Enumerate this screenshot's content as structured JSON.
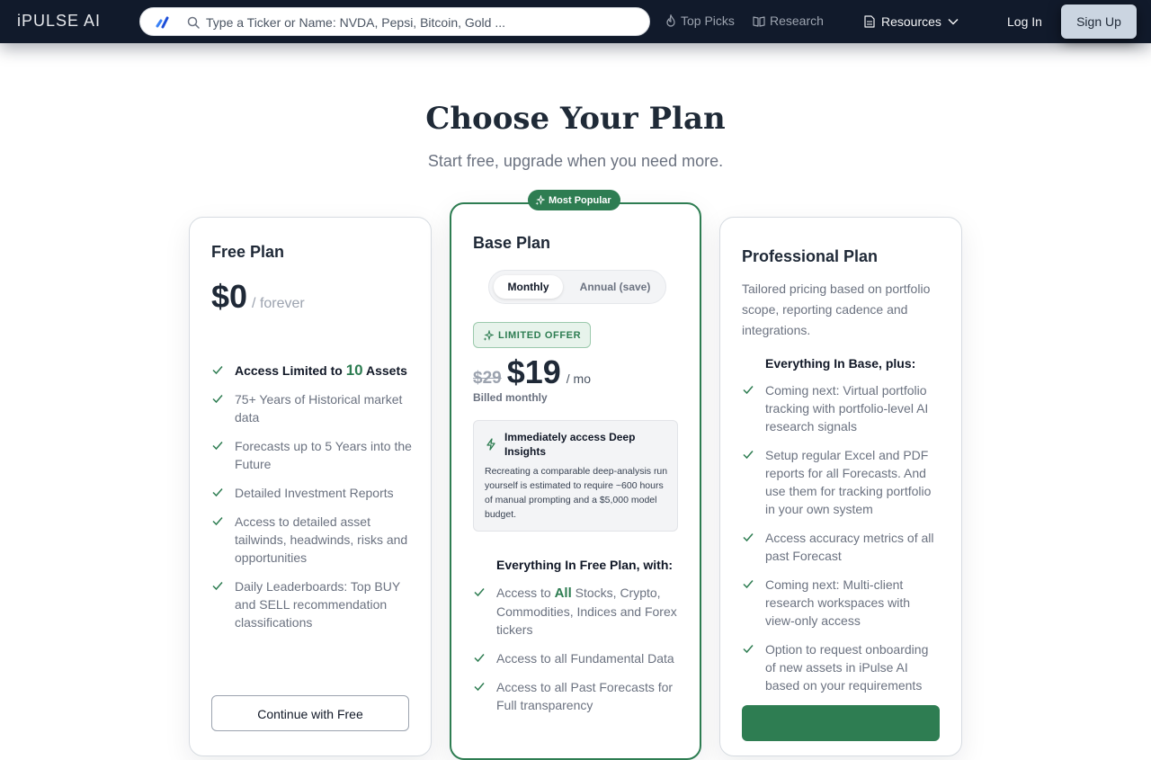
{
  "header": {
    "brand": "iPULSE AI",
    "search_placeholder": "Type a Ticker or Name: NVDA, Pepsi, Bitcoin, Gold ...",
    "nav": {
      "top_picks": "Top Picks",
      "research": "Research",
      "resources": "Resources"
    },
    "login": "Log In",
    "signup": "Sign Up"
  },
  "page": {
    "title": "Choose Your Plan",
    "subtitle": "Start free, upgrade when you need more."
  },
  "free_plan": {
    "title": "Free Plan",
    "price": "$0",
    "period": "/ forever",
    "features": [
      {
        "pre": "Access Limited to ",
        "highlight": "10",
        "post": " Assets",
        "bold": true
      },
      {
        "text": "75+ Years of Historical market data"
      },
      {
        "text": "Forecasts up to 5 Years into the Future"
      },
      {
        "text": "Detailed Investment Reports"
      },
      {
        "text": "Access to detailed asset tailwinds, headwinds, risks and opportunities"
      },
      {
        "text": "Daily Leaderboards: Top BUY and SELL recommendation classifications"
      }
    ],
    "cta": "Continue with Free"
  },
  "base_plan": {
    "badge": "Most Popular",
    "title": "Base Plan",
    "billing_options": [
      "Monthly",
      "Annual (save)"
    ],
    "offer_badge": "LIMITED OFFER",
    "old_price": "$29",
    "price": "$19",
    "period": "/ mo",
    "billing_note": "Billed monthly",
    "deep_title": "Immediately access Deep Insights",
    "deep_body": "Recreating a comparable deep-analysis run yourself is estimated to require ~600 hours of manual prompting and a $5,000 model budget.",
    "features_heading": "Everything In Free Plan, with:",
    "features": [
      {
        "pre": "Access to ",
        "highlight": "All",
        "post": " Stocks, Crypto, Commodities, Indices and Forex tickers"
      },
      {
        "text": "Access to all Fundamental Data"
      },
      {
        "text": "Access to all Past Forecasts for Full transparency"
      }
    ]
  },
  "pro_plan": {
    "title": "Professional Plan",
    "description": "Tailored pricing based on portfolio scope, reporting cadence and integrations.",
    "features_heading": "Everything In Base, plus:",
    "features": [
      {
        "text": "Coming next: Virtual portfolio tracking with portfolio-level AI research signals"
      },
      {
        "text": "Setup regular Excel and PDF reports for all Forecasts. And use them for tracking portfolio in your own system"
      },
      {
        "text": "Access accuracy metrics of all past Forecast"
      },
      {
        "text": "Coming next: Multi-client research workspaces with view-only access"
      },
      {
        "text": "Option to request onboarding of new assets in iPulse AI based on your requirements"
      }
    ]
  },
  "colors": {
    "nav_bg": "#111a2b",
    "accent_green": "#2e7d52",
    "signup_bg": "#cbd5e1"
  }
}
